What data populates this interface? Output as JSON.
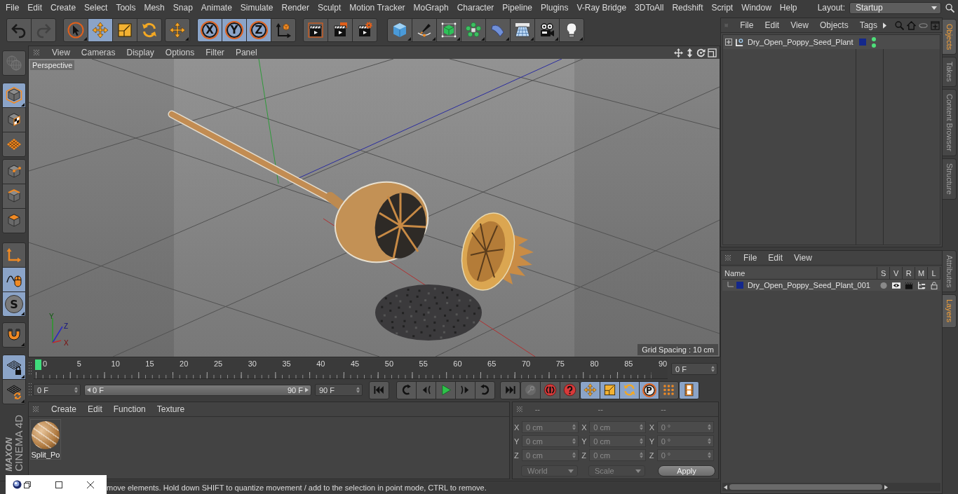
{
  "menu_bar": {
    "items": [
      "File",
      "Edit",
      "Create",
      "Select",
      "Tools",
      "Mesh",
      "Snap",
      "Animate",
      "Simulate",
      "Render",
      "Sculpt",
      "Motion Tracker",
      "MoGraph",
      "Character",
      "Pipeline",
      "Plugins",
      "V-Ray Bridge",
      "3DToAll",
      "Redshift",
      "Script",
      "Window",
      "Help"
    ],
    "layout_label": "Layout:",
    "layout_value": "Startup"
  },
  "toolbar": {
    "groups": [
      {
        "buttons": [
          {
            "kind": "undo",
            "selected": false,
            "disabled": false
          },
          {
            "kind": "redo",
            "selected": false,
            "disabled": true
          }
        ]
      },
      {
        "buttons": [
          {
            "kind": "live-select",
            "selected": false,
            "disabled": false
          },
          {
            "kind": "move",
            "selected": true,
            "disabled": false
          },
          {
            "kind": "scale",
            "selected": false,
            "disabled": false
          },
          {
            "kind": "rotate",
            "selected": false,
            "disabled": false
          }
        ]
      },
      {
        "buttons": [
          {
            "kind": "transform",
            "selected": false,
            "disabled": false
          }
        ]
      },
      {
        "buttons": [
          {
            "kind": "axis-lock",
            "label": "X",
            "selected": true,
            "disabled": false
          },
          {
            "kind": "axis-lock",
            "label": "Y",
            "selected": true,
            "disabled": false
          },
          {
            "kind": "axis-lock",
            "label": "Z",
            "selected": true,
            "disabled": false
          },
          {
            "kind": "coordinate-system",
            "selected": false,
            "disabled": false
          }
        ]
      },
      {
        "buttons": [
          {
            "kind": "render-view",
            "selected": false,
            "disabled": false
          },
          {
            "kind": "render-picture",
            "selected": false,
            "disabled": false
          },
          {
            "kind": "render-settings",
            "selected": false,
            "disabled": false
          }
        ]
      },
      {
        "buttons": [
          {
            "kind": "cube",
            "selected": false,
            "disabled": false
          },
          {
            "kind": "pen",
            "selected": false,
            "disabled": false
          },
          {
            "kind": "subdivision",
            "selected": false,
            "disabled": false
          },
          {
            "kind": "cloner",
            "selected": false,
            "disabled": false
          },
          {
            "kind": "deformer",
            "selected": false,
            "disabled": false
          },
          {
            "kind": "floor",
            "selected": false,
            "disabled": false
          },
          {
            "kind": "camera",
            "selected": false,
            "disabled": false
          },
          {
            "kind": "light",
            "selected": false,
            "disabled": false
          }
        ]
      }
    ]
  },
  "tool_palette": {
    "groups": [
      {
        "buttons": [
          {
            "kind": "make-editable",
            "selected": false,
            "disabled": true
          }
        ]
      },
      {
        "buttons": [
          {
            "kind": "model",
            "selected": true,
            "disabled": false
          },
          {
            "kind": "texture",
            "selected": false,
            "disabled": false
          },
          {
            "kind": "workplane",
            "selected": false,
            "disabled": false
          }
        ]
      },
      {
        "buttons": [
          {
            "kind": "points",
            "selected": false,
            "disabled": false
          },
          {
            "kind": "edges",
            "selected": false,
            "disabled": false
          },
          {
            "kind": "polygons",
            "selected": false,
            "disabled": false
          }
        ]
      },
      {
        "buttons": [
          {
            "kind": "axis",
            "selected": false,
            "disabled": false
          },
          {
            "kind": "tweak",
            "selected": true,
            "disabled": false
          },
          {
            "kind": "solo",
            "label": "S",
            "selected": true,
            "disabled": false
          }
        ]
      },
      {
        "buttons": [
          {
            "kind": "snap",
            "selected": false,
            "disabled": false
          }
        ]
      },
      {
        "buttons": [
          {
            "kind": "workplane-lock",
            "selected": true,
            "disabled": false
          },
          {
            "kind": "workplane-cycle",
            "selected": false,
            "disabled": false
          }
        ]
      }
    ]
  },
  "logo": {
    "brand": "MAXON",
    "product": "CINEMA 4D"
  },
  "viewport": {
    "menu": [
      "View",
      "Cameras",
      "Display",
      "Options",
      "Filter",
      "Panel"
    ],
    "camera": "Perspective",
    "axis_labels": [
      "Y",
      "Z",
      "X"
    ],
    "grid_spacing": "Grid Spacing : 10 cm"
  },
  "timeline": {
    "ticks": [
      "0",
      "5",
      "10",
      "15",
      "20",
      "25",
      "30",
      "35",
      "40",
      "45",
      "50",
      "55",
      "60",
      "65",
      "70",
      "75",
      "80",
      "85",
      "90"
    ],
    "level": 0,
    "current_frame": "0 F"
  },
  "playback": {
    "start": "0 F",
    "range": {
      "start": "0 F",
      "end": "90 F",
      "level": 1
    },
    "end": "90 F",
    "groups": [
      {
        "buttons": [
          {
            "kind": "go-start",
            "selected": false,
            "disabled": false
          }
        ]
      },
      {
        "buttons": [
          {
            "kind": "prev-key",
            "selected": false,
            "disabled": false
          },
          {
            "kind": "prev-frame",
            "selected": false,
            "disabled": false
          },
          {
            "kind": "play",
            "selected": false,
            "disabled": false
          },
          {
            "kind": "next-frame",
            "selected": false,
            "disabled": false
          },
          {
            "kind": "next-key",
            "selected": false,
            "disabled": false
          }
        ]
      },
      {
        "buttons": [
          {
            "kind": "go-end",
            "selected": false,
            "disabled": false
          }
        ]
      },
      {
        "buttons": [
          {
            "kind": "record",
            "selected": false,
            "disabled": true
          },
          {
            "kind": "autokey",
            "selected": false,
            "disabled": false
          },
          {
            "kind": "key-selection",
            "selected": false,
            "disabled": false
          }
        ]
      },
      {
        "buttons": [
          {
            "kind": "position",
            "selected": true,
            "disabled": false
          },
          {
            "kind": "scale",
            "selected": true,
            "disabled": false
          },
          {
            "kind": "rotate",
            "selected": true,
            "disabled": false
          },
          {
            "kind": "parameter",
            "label": "P",
            "selected": true,
            "disabled": false
          },
          {
            "kind": "point-level",
            "selected": false,
            "disabled": false
          }
        ]
      },
      {
        "buttons": [
          {
            "kind": "timeline",
            "selected": true,
            "disabled": false
          }
        ]
      }
    ]
  },
  "material_manager": {
    "menu": [
      "Create",
      "Edit",
      "Function",
      "Texture"
    ],
    "materials": [
      {
        "name": "Split_Po"
      }
    ]
  },
  "coordinates": {
    "columns": [
      {
        "header": "--",
        "fields": [
          {
            "axis": "X",
            "value": "0 cm"
          },
          {
            "axis": "Y",
            "value": "0 cm"
          },
          {
            "axis": "Z",
            "value": "0 cm"
          }
        ]
      },
      {
        "header": "--",
        "fields": [
          {
            "axis": "X",
            "value": "0 cm"
          },
          {
            "axis": "Y",
            "value": "0 cm"
          },
          {
            "axis": "Z",
            "value": "0 cm"
          }
        ]
      },
      {
        "header": "--",
        "fields": [
          {
            "axis": "X",
            "value": "0 °"
          },
          {
            "axis": "Y",
            "value": "0 °"
          },
          {
            "axis": "Z",
            "value": "0 °"
          }
        ]
      }
    ],
    "dropdowns": [
      {
        "value": "World",
        "disabled": true
      },
      {
        "value": "Scale",
        "disabled": true
      }
    ],
    "apply": "Apply"
  },
  "status_bar": {
    "text": "move elements. Hold down SHIFT to quantize movement / add to the selection in point mode, CTRL to remove."
  },
  "objects_manager": {
    "menu": [
      "File",
      "Edit",
      "View",
      "Objects",
      "Tags"
    ],
    "objects": [
      {
        "name": "Dry_Open_Poppy_Seed_Plant",
        "expanded": false,
        "color": "#14288c",
        "editor_visible": true,
        "render_visible": true
      }
    ]
  },
  "layers_manager": {
    "menu": [
      "File",
      "Edit",
      "View"
    ],
    "columns": [
      "Name",
      "S",
      "V",
      "R",
      "M",
      "L"
    ],
    "layers": [
      {
        "name": "Dry_Open_Poppy_Seed_Plant_001",
        "color": "#14288c",
        "solo": false,
        "visible": true,
        "render": true,
        "manager": true,
        "locked": false
      }
    ]
  },
  "side_tabs": {
    "upper": [
      {
        "label": "Objects",
        "selected": true
      },
      {
        "label": "Takes",
        "selected": false
      },
      {
        "label": "Content Browser",
        "selected": false
      },
      {
        "label": "Structure",
        "selected": false
      }
    ],
    "lower": [
      {
        "label": "Attributes",
        "selected": false
      },
      {
        "label": "Layers",
        "selected": true
      }
    ]
  }
}
